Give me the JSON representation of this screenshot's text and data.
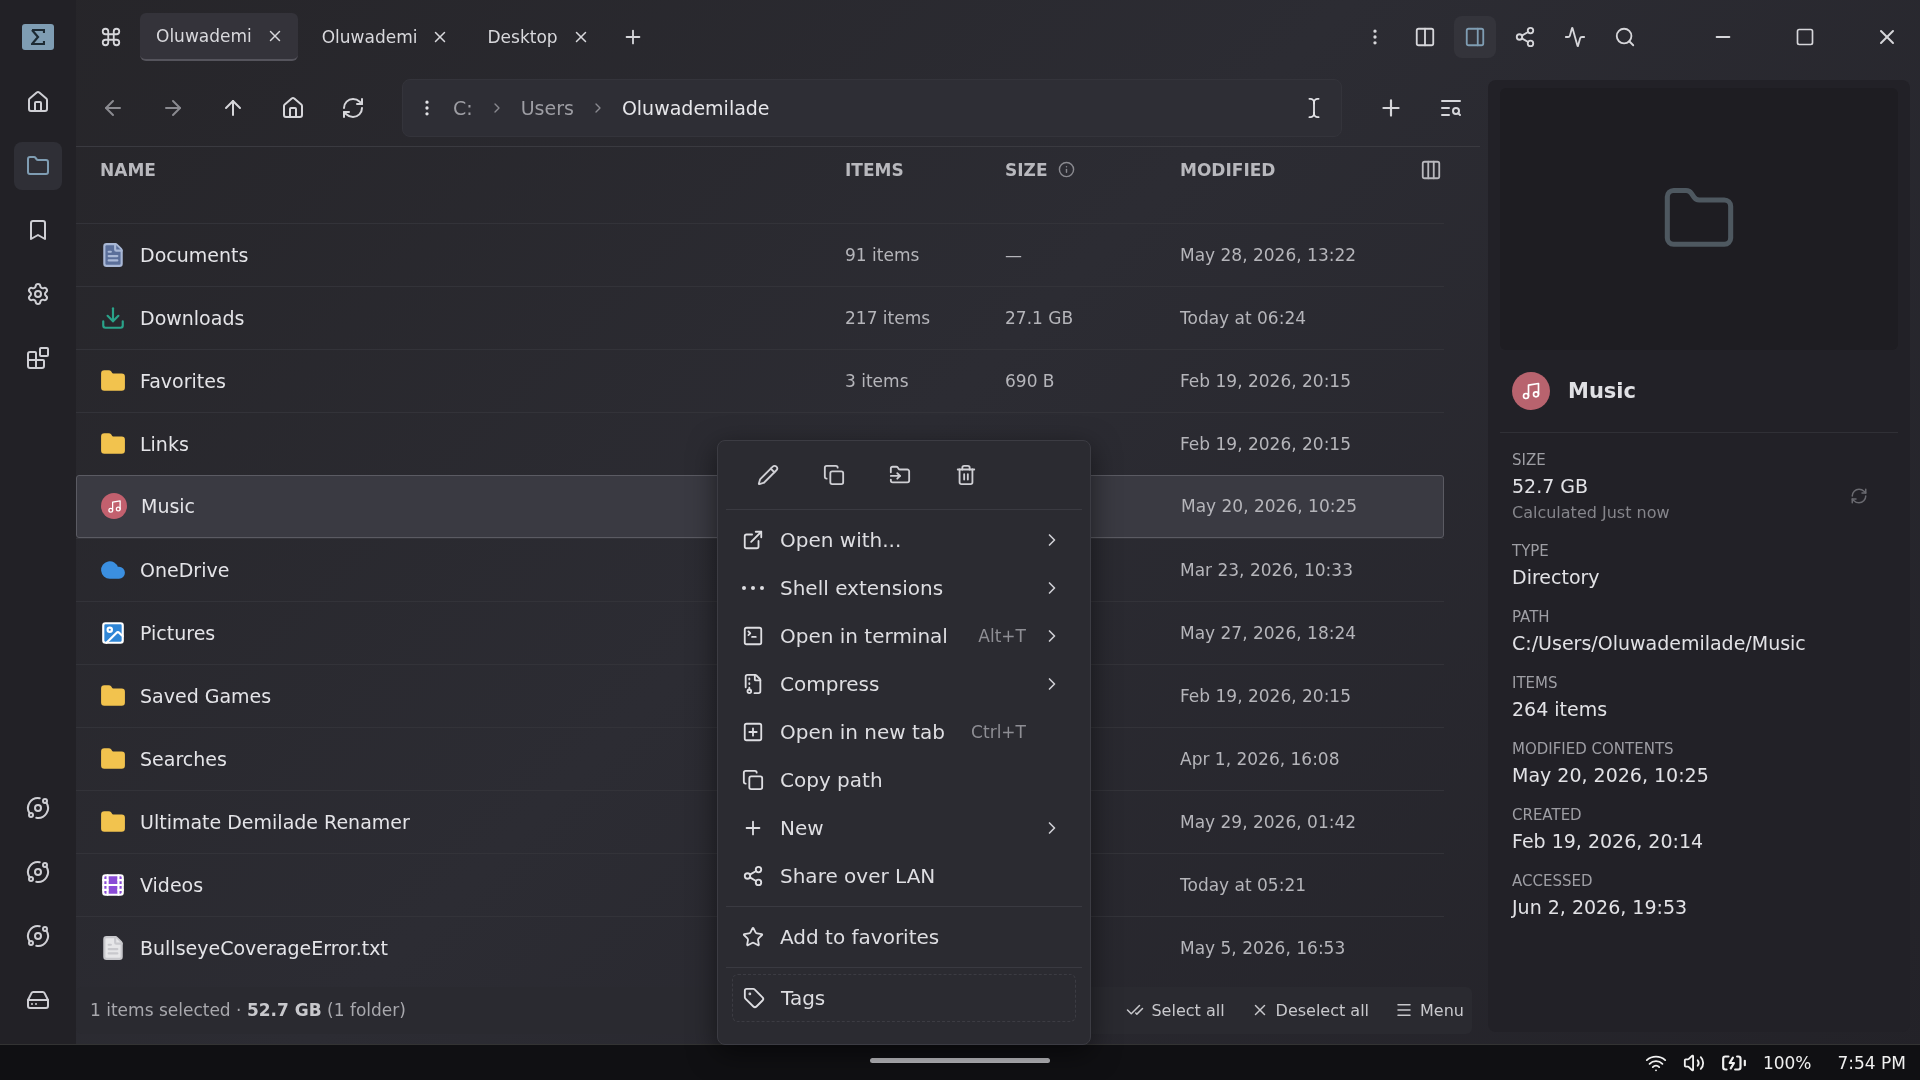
{
  "tabs": [
    {
      "label": "Oluwademi",
      "selected": true
    },
    {
      "label": "Oluwademi",
      "selected": false
    },
    {
      "label": "Desktop",
      "selected": false
    }
  ],
  "breadcrumb": [
    "C:",
    "Users",
    "Oluwademilade"
  ],
  "columns": [
    "NAME",
    "ITEMS",
    "SIZE",
    "MODIFIED"
  ],
  "rows": [
    {
      "kind": "documents",
      "name": "Documents",
      "items": "91 items",
      "size": "—",
      "modified": "May 28, 2026, 13:22",
      "selected": false
    },
    {
      "kind": "downloads",
      "name": "Downloads",
      "items": "217 items",
      "size": "27.1 GB",
      "modified": "Today at 06:24",
      "selected": false
    },
    {
      "kind": "folder",
      "name": "Favorites",
      "items": "3 items",
      "size": "690 B",
      "modified": "Feb 19, 2026, 20:15",
      "selected": false
    },
    {
      "kind": "folder",
      "name": "Links",
      "modified": "Feb 19, 2026, 20:15",
      "selected": false
    },
    {
      "kind": "music",
      "name": "Music",
      "modified": "May 20, 2026, 10:25",
      "selected": true
    },
    {
      "kind": "onedrive",
      "name": "OneDrive",
      "modified": "Mar 23, 2026, 10:33",
      "selected": false
    },
    {
      "kind": "pictures",
      "name": "Pictures",
      "modified": "May 27, 2026, 18:24",
      "selected": false
    },
    {
      "kind": "folder",
      "name": "Saved Games",
      "modified": "Feb 19, 2026, 20:15",
      "selected": false
    },
    {
      "kind": "folder",
      "name": "Searches",
      "modified": "Apr 1, 2026, 16:08",
      "selected": false
    },
    {
      "kind": "folder",
      "name": "Ultimate Demilade Renamer",
      "modified": "May 29, 2026, 01:42",
      "selected": false
    },
    {
      "kind": "videos",
      "name": "Videos",
      "modified": "Today at 05:21",
      "selected": false
    },
    {
      "kind": "text",
      "name": "BullseyeCoverageError.txt",
      "modified": "May 5, 2026, 16:53",
      "selected": false
    }
  ],
  "context_menu": {
    "sections": [
      {
        "items": [
          {
            "kind": "open-with",
            "label": "Open with...",
            "submenu": true
          },
          {
            "kind": "shell",
            "label": "Shell extensions",
            "submenu": true
          },
          {
            "kind": "terminal",
            "label": "Open in terminal",
            "shortcut": "Alt+T",
            "submenu": true
          },
          {
            "kind": "compress",
            "label": "Compress",
            "submenu": true
          },
          {
            "kind": "new-tab",
            "label": "Open in new tab",
            "shortcut": "Ctrl+T",
            "submenu": false
          },
          {
            "kind": "copy-path",
            "label": "Copy path",
            "submenu": false
          },
          {
            "kind": "new",
            "label": "New",
            "submenu": true
          },
          {
            "kind": "share",
            "label": "Share over LAN",
            "submenu": false
          }
        ]
      },
      {
        "items": [
          {
            "kind": "favorite",
            "label": "Add to favorites",
            "submenu": false
          }
        ]
      },
      {
        "items": [
          {
            "kind": "tags",
            "label": "Tags",
            "submenu": false
          }
        ]
      }
    ]
  },
  "details": {
    "title": "Music",
    "fields": [
      {
        "label": "SIZE",
        "value": "52.7 GB",
        "note": "Calculated Just now"
      },
      {
        "label": "TYPE",
        "value": "Directory"
      },
      {
        "label": "PATH",
        "value": "C:/Users/Oluwademilade/Music"
      },
      {
        "label": "ITEMS",
        "value": "264 items"
      },
      {
        "label": "MODIFIED CONTENTS",
        "value": "May 20, 2026, 10:25"
      },
      {
        "label": "CREATED",
        "value": "Feb 19, 2026, 20:14"
      },
      {
        "label": "ACCESSED",
        "value": "Jun 2, 2026, 19:53"
      }
    ]
  },
  "status_bar": {
    "selection": "1 items selected · **52.7 GB** (1 folder)",
    "actions": [
      {
        "kind": "select-all",
        "label": "Select all"
      },
      {
        "kind": "deselect-all",
        "label": "Deselect all"
      },
      {
        "kind": "menu",
        "label": "Menu"
      }
    ]
  },
  "taskbar": {
    "battery": "100%",
    "time": "7:54 PM"
  }
}
